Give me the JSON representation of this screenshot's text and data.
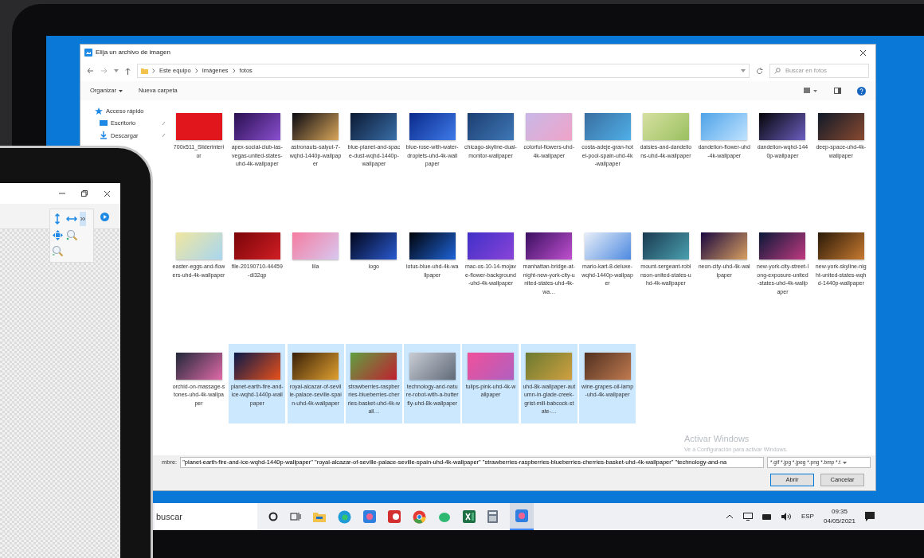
{
  "dialog": {
    "title": "Elija un archivo de imagen",
    "breadcrumb": [
      "Este equipo",
      "Imágenes",
      "fotos"
    ],
    "search": {
      "placeholder": "Buscar en fotos"
    },
    "organize": "Organizar",
    "new_folder": "Nueva carpeta",
    "sidebar": [
      {
        "label": "Acceso rápido",
        "kind": "quick"
      },
      {
        "label": "Escritorio",
        "kind": "desktop"
      },
      {
        "label": "Descargar",
        "kind": "downloads"
      }
    ],
    "files": [
      {
        "name": "700x511_Sliderinterior",
        "selected": false
      },
      {
        "name": "apex-social-club-las-vegas-united-states-uhd-4k-wallpaper",
        "selected": false
      },
      {
        "name": "astronauts-salyut-7-wqhd-1440p-wallpaper",
        "selected": false
      },
      {
        "name": "blue-planet-and-space-dust-wqhd-1440p-wallpaper",
        "selected": false
      },
      {
        "name": "blue-rose-with-water-droplets-uhd-4k-wallpaper",
        "selected": false
      },
      {
        "name": "chicago-skyline-dual-monitor-wallpaper",
        "selected": false
      },
      {
        "name": "colorful-flowers-uhd-4k-wallpaper",
        "selected": false
      },
      {
        "name": "costa-adeje-gran-hotel-pool-spain-uhd-4k-wallpaper",
        "selected": false
      },
      {
        "name": "daisies-and-dandelions-uhd-4k-wallpaper",
        "selected": false
      },
      {
        "name": "dandelion-flower-uhd-4k-wallpaper",
        "selected": false
      },
      {
        "name": "dandelion-wqhd-1440p-wallpaper",
        "selected": false
      },
      {
        "name": "deep-space-uhd-4k-wallpaper",
        "selected": false
      },
      {
        "name": "easter-eggs-and-flowers-uhd-4k-wallpaper",
        "selected": false
      },
      {
        "name": "file-20190710-44459-di32qp",
        "selected": false
      },
      {
        "name": "lila",
        "selected": false
      },
      {
        "name": "logo",
        "selected": false
      },
      {
        "name": "lotus-blue-uhd-4k-wallpaper",
        "selected": false
      },
      {
        "name": "mac-os-10-14-mojave-flower-background-uhd-4k-wallpaper",
        "selected": false
      },
      {
        "name": "manhattan-bridge-at-night-new-york-city-united-states-uhd-4k-wa…",
        "selected": false
      },
      {
        "name": "mario-kart-8-deluxe-wqhd-1440p-wallpaper",
        "selected": false
      },
      {
        "name": "mount-sergeant-robinson-united-states-uhd-4k-wallpaper",
        "selected": false
      },
      {
        "name": "neon-city-uhd-4k-wallpaper",
        "selected": false
      },
      {
        "name": "new-york-city-street-long-exposure-united-states-uhd-4k-wallpaper",
        "selected": false
      },
      {
        "name": "new-york-skyline-night-united-states-wqhd-1440p-wallpaper",
        "selected": false
      },
      {
        "name": "orchid-on-massage-stones-uhd-4k-wallpaper",
        "selected": false
      },
      {
        "name": "planet-earth-fire-and-ice-wqhd-1440p-wallpaper",
        "selected": true
      },
      {
        "name": "royal-alcazar-of-seville-palace-seville-spain-uhd-4k-wallpaper",
        "selected": true
      },
      {
        "name": "strawberries-raspberries-blueberries-cherries-basket-uhd-4k-wall…",
        "selected": true
      },
      {
        "name": "technology-and-nature-robot-with-a-butterfly-uhd-8k-wallpaper",
        "selected": true
      },
      {
        "name": "tulips-pink-uhd-4k-wallpaper",
        "selected": true
      },
      {
        "name": "uhd-8k-wallpaper-autumn-in-glade-creek-grist-mill-babcock-state-…",
        "selected": true
      },
      {
        "name": "wine-grapes-oil-lamp-uhd-4k-wallpaper",
        "selected": true
      }
    ],
    "filename": {
      "label": "mbre:",
      "value": "\"planet-earth-fire-and-ice-wqhd-1440p-wallpaper\" \"royal-alcazar-of-seville-palace-seville-spain-uhd-4k-wallpaper\" \"strawberries-raspberries-blueberries-cherries-basket-uhd-4k-wallpaper\" \"technology-and-na"
    },
    "filter": "*.gif *.jpg *.jpeg *.png *.bmp *.t",
    "buttons": [
      "Abrir",
      "Cancelar"
    ]
  },
  "activation": [
    "Activar Windows",
    "Ve a Configuración para activar Windows."
  ],
  "taskbar": {
    "search": "buscar",
    "language": "ESP",
    "time": "09:35",
    "date": "04/05/2021"
  }
}
